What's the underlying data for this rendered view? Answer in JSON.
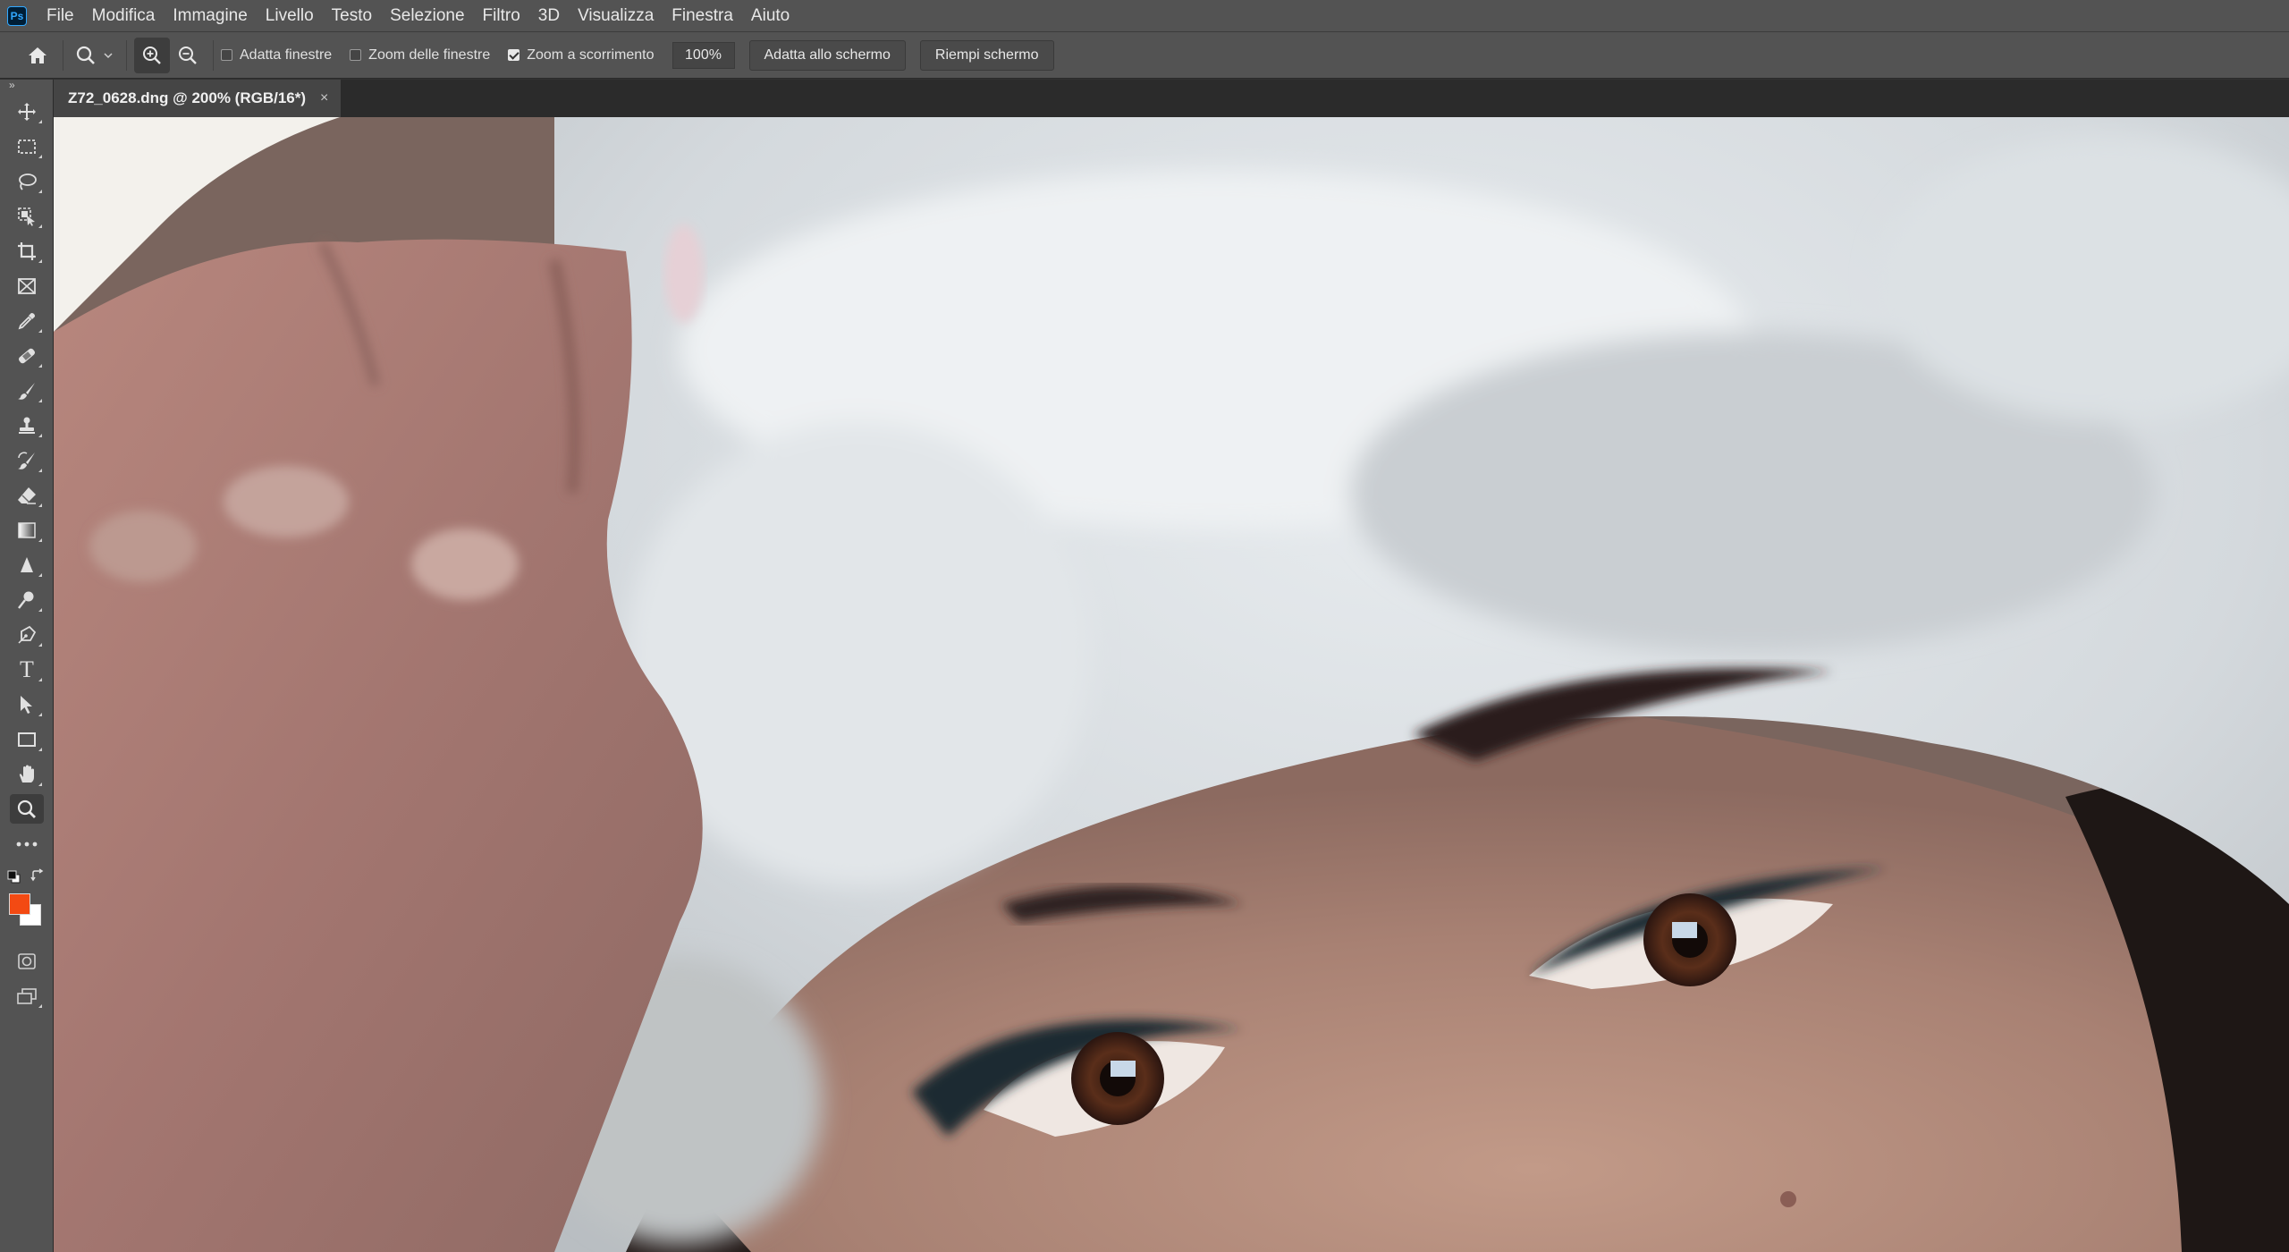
{
  "app": {
    "logo_text": "Ps",
    "logo_color": "#31a8ff"
  },
  "menu": {
    "items": [
      "File",
      "Modifica",
      "Immagine",
      "Livello",
      "Testo",
      "Selezione",
      "Filtro",
      "3D",
      "Visualizza",
      "Finestra",
      "Aiuto"
    ]
  },
  "options": {
    "home_icon": "home-icon",
    "zoom_tool_icon": "zoom-tool-icon",
    "zoom_in_icon": "zoom-in-icon",
    "zoom_out_icon": "zoom-out-icon",
    "resize_windows": {
      "label": "Adatta finestre",
      "checked": false
    },
    "zoom_all_windows": {
      "label": "Zoom delle finestre",
      "checked": false
    },
    "scrubby_zoom": {
      "label": "Zoom a scorrimento",
      "checked": true
    },
    "zoom_value": "100%",
    "fit_screen_label": "Adatta allo schermo",
    "fill_screen_label": "Riempi schermo"
  },
  "document": {
    "tab_title": "Z72_0628.dng @ 200% (RGB/16*)",
    "close_glyph": "×"
  },
  "toolbar": {
    "collapse_glyph": "»",
    "tools": [
      {
        "name": "move-tool",
        "icon": "move-icon"
      },
      {
        "name": "marquee-tool",
        "icon": "marquee-icon"
      },
      {
        "name": "lasso-tool",
        "icon": "lasso-icon"
      },
      {
        "name": "object-selection-tool",
        "icon": "object-selection-icon"
      },
      {
        "name": "crop-tool",
        "icon": "crop-icon"
      },
      {
        "name": "frame-tool",
        "icon": "frame-icon"
      },
      {
        "name": "eyedropper-tool",
        "icon": "eyedropper-icon"
      },
      {
        "name": "healing-brush-tool",
        "icon": "bandage-icon"
      },
      {
        "name": "brush-tool",
        "icon": "brush-icon"
      },
      {
        "name": "clone-stamp-tool",
        "icon": "stamp-icon"
      },
      {
        "name": "history-brush-tool",
        "icon": "history-brush-icon"
      },
      {
        "name": "eraser-tool",
        "icon": "eraser-icon"
      },
      {
        "name": "gradient-tool",
        "icon": "gradient-icon"
      },
      {
        "name": "blur-tool",
        "icon": "blur-icon"
      },
      {
        "name": "dodge-tool",
        "icon": "dodge-icon"
      },
      {
        "name": "pen-tool",
        "icon": "pen-icon"
      },
      {
        "name": "type-tool",
        "icon": "type-icon"
      },
      {
        "name": "path-selection-tool",
        "icon": "arrow-icon"
      },
      {
        "name": "rectangle-tool",
        "icon": "rectangle-icon"
      },
      {
        "name": "hand-tool",
        "icon": "hand-icon"
      },
      {
        "name": "zoom-tool",
        "icon": "magnifier-icon",
        "active": true
      },
      {
        "name": "more-tools",
        "icon": "ellipsis-icon"
      }
    ],
    "type_glyph": "T",
    "foreground_color": "#f34a13",
    "background_color": "#ffffff"
  }
}
